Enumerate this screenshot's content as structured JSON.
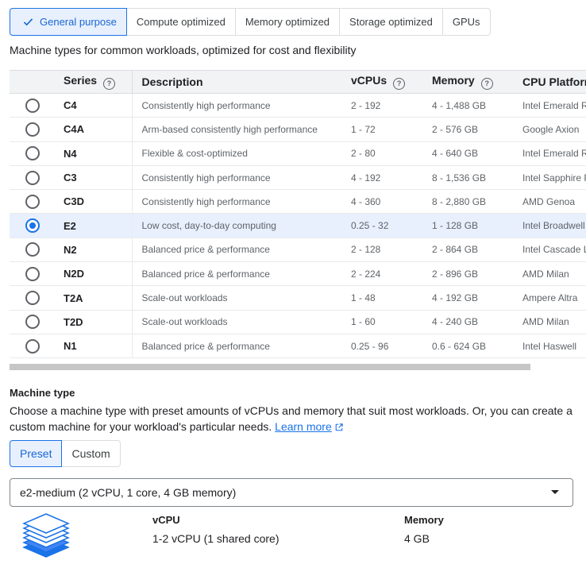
{
  "family_tabs": [
    {
      "label": "General purpose",
      "selected": true
    },
    {
      "label": "Compute optimized",
      "selected": false
    },
    {
      "label": "Memory optimized",
      "selected": false
    },
    {
      "label": "Storage optimized",
      "selected": false
    },
    {
      "label": "GPUs",
      "selected": false
    }
  ],
  "family_description": "Machine types for common workloads, optimized for cost and flexibility",
  "table": {
    "headers": {
      "series": "Series",
      "description": "Description",
      "vcpus": "vCPUs",
      "memory": "Memory",
      "cpu_platform": "CPU Platform"
    },
    "rows": [
      {
        "series": "C4",
        "description": "Consistently high performance",
        "vcpus": "2 - 192",
        "memory": "4 - 1,488 GB",
        "cpu_platform": "Intel Emerald Rapids",
        "selected": false
      },
      {
        "series": "C4A",
        "description": "Arm-based consistently high performance",
        "vcpus": "1 - 72",
        "memory": "2 - 576 GB",
        "cpu_platform": "Google Axion",
        "selected": false
      },
      {
        "series": "N4",
        "description": "Flexible & cost-optimized",
        "vcpus": "2 - 80",
        "memory": "4 - 640 GB",
        "cpu_platform": "Intel Emerald Rapids",
        "selected": false
      },
      {
        "series": "C3",
        "description": "Consistently high performance",
        "vcpus": "4 - 192",
        "memory": "8 - 1,536 GB",
        "cpu_platform": "Intel Sapphire Rapids",
        "selected": false
      },
      {
        "series": "C3D",
        "description": "Consistently high performance",
        "vcpus": "4 - 360",
        "memory": "8 - 2,880 GB",
        "cpu_platform": "AMD Genoa",
        "selected": false
      },
      {
        "series": "E2",
        "description": "Low cost, day-to-day computing",
        "vcpus": "0.25 - 32",
        "memory": "1 - 128 GB",
        "cpu_platform": "Intel Broadwell",
        "selected": true
      },
      {
        "series": "N2",
        "description": "Balanced price & performance",
        "vcpus": "2 - 128",
        "memory": "2 - 864 GB",
        "cpu_platform": "Intel Cascade Lake",
        "selected": false
      },
      {
        "series": "N2D",
        "description": "Balanced price & performance",
        "vcpus": "2 - 224",
        "memory": "2 - 896 GB",
        "cpu_platform": "AMD Milan",
        "selected": false
      },
      {
        "series": "T2A",
        "description": "Scale-out workloads",
        "vcpus": "1 - 48",
        "memory": "4 - 192 GB",
        "cpu_platform": "Ampere Altra",
        "selected": false
      },
      {
        "series": "T2D",
        "description": "Scale-out workloads",
        "vcpus": "1 - 60",
        "memory": "4 - 240 GB",
        "cpu_platform": "AMD Milan",
        "selected": false
      },
      {
        "series": "N1",
        "description": "Balanced price & performance",
        "vcpus": "0.25 - 96",
        "memory": "0.6 - 624 GB",
        "cpu_platform": "Intel Haswell",
        "selected": false
      }
    ]
  },
  "machine_type": {
    "title": "Machine type",
    "description": "Choose a machine type with preset amounts of vCPUs and memory that suit most workloads. Or, you can create a custom machine for your workload's particular needs.",
    "learn_more": "Learn more",
    "modes": [
      {
        "label": "Preset",
        "selected": true
      },
      {
        "label": "Custom",
        "selected": false
      }
    ],
    "selected_type": "e2-medium (2 vCPU, 1 core, 4 GB memory)",
    "specs": {
      "vcpu_label": "vCPU",
      "vcpu_value": "1-2 vCPU (1 shared core)",
      "memory_label": "Memory",
      "memory_value": "4 GB"
    }
  },
  "colors": {
    "accent": "#1a73e8",
    "selected_bg": "#e8f0fe"
  }
}
